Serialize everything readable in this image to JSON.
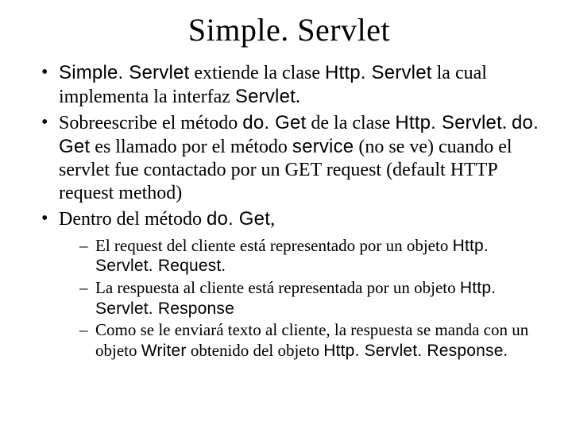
{
  "title": "Simple. Servlet",
  "bullets": [
    {
      "parts": [
        {
          "t": "Simple. Servlet",
          "cls": "code"
        },
        {
          "t": " extiende la clase  "
        },
        {
          "t": "Http. Servlet",
          "cls": "code"
        },
        {
          "t": " la cual implementa la interfaz "
        },
        {
          "t": "Servlet",
          "cls": "code"
        },
        {
          "t": "."
        }
      ]
    },
    {
      "parts": [
        {
          "t": "Sobreescribe el método "
        },
        {
          "t": "do. Get",
          "cls": "code"
        },
        {
          "t": " de la clase "
        },
        {
          "t": "Http. Servlet",
          "cls": "code"
        },
        {
          "t": ". "
        },
        {
          "t": "do. Get",
          "cls": "code"
        },
        {
          "t": " es llamado por el método "
        },
        {
          "t": "service",
          "cls": "code"
        },
        {
          "t": " (no se ve) cuando el servlet fue contactado por un  GET request (default HTTP request method)"
        }
      ]
    },
    {
      "parts": [
        {
          "t": "Dentro del método "
        },
        {
          "t": "do. Get",
          "cls": "code"
        },
        {
          "t": ","
        }
      ],
      "sub": [
        {
          "parts": [
            {
              "t": "El request del cliente está representado por un objeto "
            },
            {
              "t": "Http. Servlet. Request",
              "cls": "code"
            },
            {
              "t": "."
            }
          ]
        },
        {
          "parts": [
            {
              "t": "La respuesta al cliente está representada por un objeto "
            },
            {
              "t": "Http. Servlet. Response",
              "cls": "code"
            }
          ]
        },
        {
          "parts": [
            {
              "t": "Como se le enviará texto al cliente, la respuesta se manda con un objeto  "
            },
            {
              "t": "Writer",
              "cls": "code"
            },
            {
              "t": " obtenido del objeto "
            },
            {
              "t": "Http. Servlet. Response",
              "cls": "code"
            },
            {
              "t": "."
            }
          ]
        }
      ]
    }
  ]
}
